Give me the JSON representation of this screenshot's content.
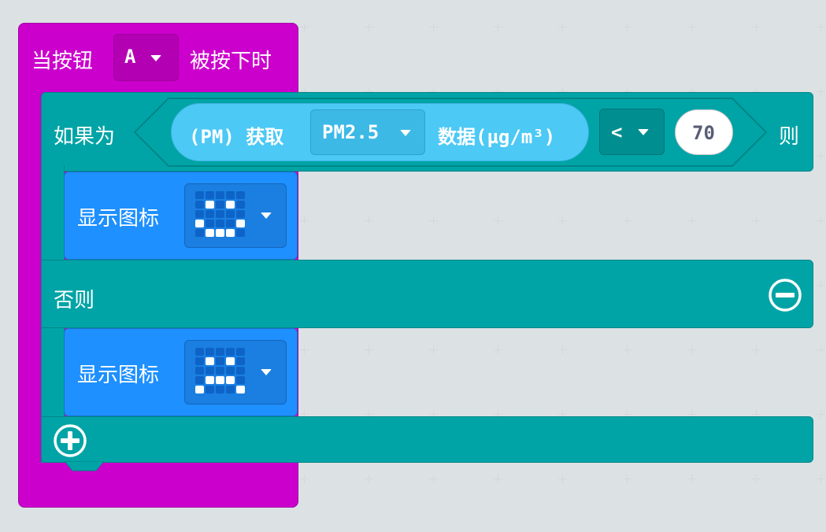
{
  "on_button": {
    "prefix": "当按钮",
    "button": "A",
    "suffix": "被按下时"
  },
  "if_block": {
    "if_label": "如果为",
    "sensor_prefix": "(PM) 获取",
    "sensor_option": "PM2.5",
    "sensor_suffix": "数据(µg/m³)",
    "operator": "<",
    "value": "70",
    "then_label": "则",
    "else_label": "否则"
  },
  "show_icon_1": {
    "label": "显示图标",
    "leds": [
      0,
      0,
      0,
      0,
      0,
      0,
      1,
      0,
      1,
      0,
      0,
      0,
      0,
      0,
      0,
      1,
      0,
      0,
      0,
      1,
      0,
      1,
      1,
      1,
      0
    ]
  },
  "show_icon_2": {
    "label": "显示图标",
    "leds": [
      0,
      0,
      0,
      0,
      0,
      0,
      1,
      0,
      1,
      0,
      0,
      0,
      0,
      0,
      0,
      0,
      1,
      1,
      1,
      0,
      1,
      0,
      0,
      0,
      1
    ]
  },
  "colors": {
    "event": "#CC00CC",
    "logic": "#00A4A6",
    "basic": "#1E90FF",
    "sensor": "#4CC9F5",
    "workspace": "#ECEFF1"
  },
  "icons": {
    "remove": "minus-circle-icon",
    "add": "plus-circle-icon",
    "dropdown": "caret-down-icon"
  }
}
